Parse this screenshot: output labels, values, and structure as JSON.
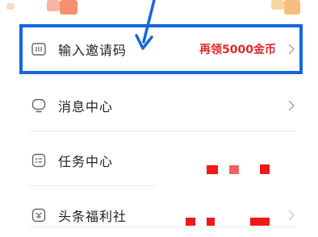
{
  "menu": {
    "items": [
      {
        "label": "输入邀请码",
        "icon": "invite-code-icon",
        "reward": "再领5000金币"
      },
      {
        "label": "消息中心",
        "icon": "message-icon"
      },
      {
        "label": "任务中心",
        "icon": "task-list-icon"
      },
      {
        "label": "头条福利社",
        "icon": "welfare-icon"
      }
    ]
  },
  "colors": {
    "highlight_border": "#1565e0",
    "reward_text": "#e0282a",
    "arrow": "#1565e0"
  }
}
